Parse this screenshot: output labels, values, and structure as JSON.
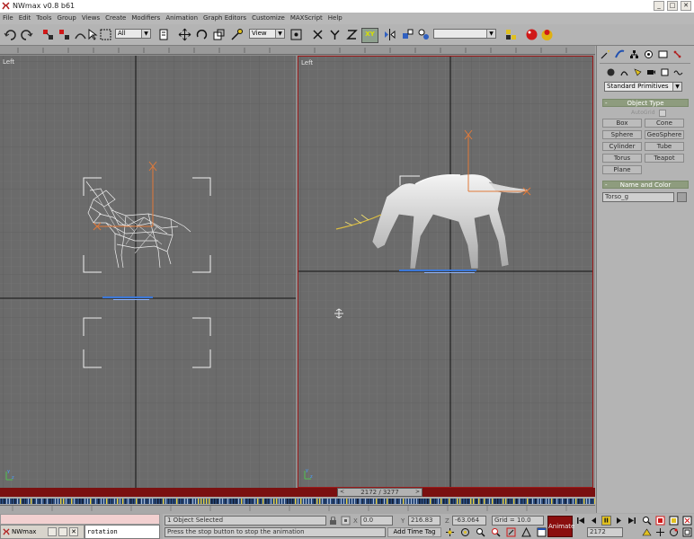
{
  "window": {
    "title": "NWmax v0.8 b61",
    "min": "_",
    "max": "□",
    "close": "✕"
  },
  "menu": [
    "File",
    "Edit",
    "Tools",
    "Group",
    "Views",
    "Create",
    "Modifiers",
    "Animation",
    "Graph Editors",
    "Customize",
    "MAXScript",
    "Help"
  ],
  "toolbar": {
    "selection_filter": "All",
    "reference_coord": "View",
    "constraint_xy": "XY",
    "named_selection": ""
  },
  "viewports": {
    "left_label": "Left",
    "right_label": "Left"
  },
  "command_panel": {
    "category": "Standard Primitives",
    "object_type_header": "Object Type",
    "autogrid_label": "AutoGrid",
    "buttons": [
      "Box",
      "Cone",
      "Sphere",
      "GeoSphere",
      "Cylinder",
      "Tube",
      "Torus",
      "Teapot",
      "Plane"
    ],
    "name_color_header": "Name and Color",
    "object_name": "Torso_g"
  },
  "timeline": {
    "frame_display": "2172 / 3277"
  },
  "taskbar": {
    "app_label": "NWmax",
    "rotation_label": "rotation"
  },
  "status": {
    "selection": "1 Object Selected",
    "prompt": "Press the stop button to stop the animation",
    "x_label": "X",
    "x_value": "0.0",
    "y_label": "Y",
    "y_value": "216.83",
    "z_label": "Z",
    "z_value": "-63.064",
    "grid": "Grid = 10.0",
    "add_time_tag": "Add Time Tag",
    "animate_label": "Animate",
    "current_frame": "2172"
  },
  "colors": {
    "animate_active": "#8a0e0e",
    "time_slider_bg": "#7a1010",
    "viewport_bg": "#6b6b6b",
    "active_viewport_border": "#9c1a1a"
  }
}
